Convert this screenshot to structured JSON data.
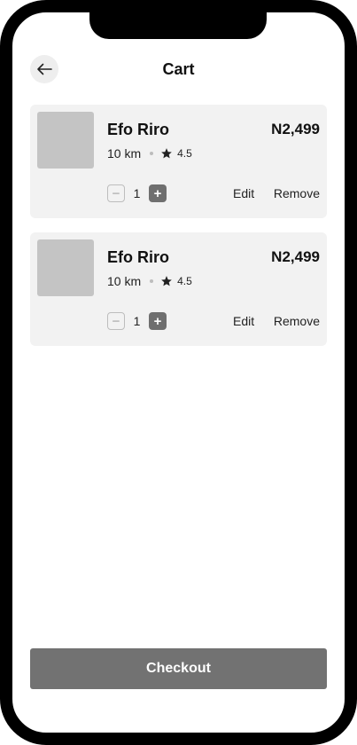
{
  "header": {
    "title": "Cart",
    "back_icon": "arrow-left-icon"
  },
  "cart_items": [
    {
      "name": "Efo Riro",
      "price": "N2,499",
      "distance": "10 km",
      "rating": "4.5",
      "quantity": "1",
      "minus_label": "−",
      "plus_label": "+",
      "edit_label": "Edit",
      "remove_label": "Remove"
    },
    {
      "name": "Efo Riro",
      "price": "N2,499",
      "distance": "10 km",
      "rating": "4.5",
      "quantity": "1",
      "minus_label": "−",
      "plus_label": "+",
      "edit_label": "Edit",
      "remove_label": "Remove"
    }
  ],
  "checkout": {
    "label": "Checkout"
  },
  "colors": {
    "card_bg": "#f2f2f2",
    "thumb_bg": "#c4c4c4",
    "button_bg": "#727272",
    "frame": "#000000"
  }
}
